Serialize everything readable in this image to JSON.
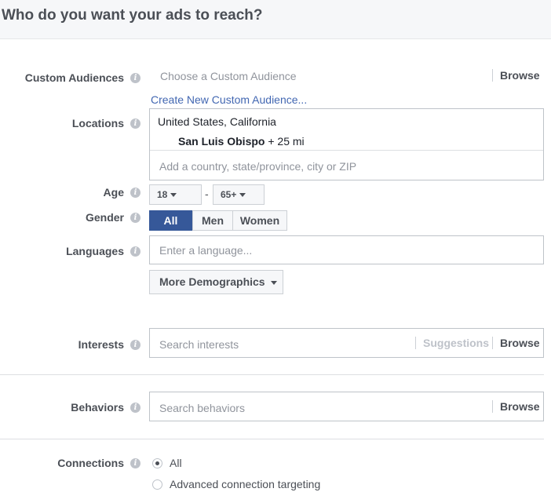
{
  "header": {
    "title": "Who do you want your ads to reach?"
  },
  "custom_audiences": {
    "label": "Custom Audiences",
    "placeholder": "Choose a Custom Audience",
    "browse": "Browse",
    "create_link": "Create New Custom Audience..."
  },
  "locations": {
    "label": "Locations",
    "region": "United States, California",
    "city": "San Luis Obispo",
    "radius": "+ 25 mi",
    "placeholder": "Add a country, state/province, city or ZIP"
  },
  "age": {
    "label": "Age",
    "min": "18",
    "separator": "-",
    "max": "65+"
  },
  "gender": {
    "label": "Gender",
    "options": [
      "All",
      "Men",
      "Women"
    ],
    "selected": "All"
  },
  "languages": {
    "label": "Languages",
    "placeholder": "Enter a language...",
    "more_demographics": "More Demographics"
  },
  "interests": {
    "label": "Interests",
    "placeholder": "Search interests",
    "suggestions": "Suggestions",
    "browse": "Browse"
  },
  "behaviors": {
    "label": "Behaviors",
    "placeholder": "Search behaviors",
    "browse": "Browse"
  },
  "connections": {
    "label": "Connections",
    "options": [
      "All",
      "Advanced connection targeting"
    ],
    "selected": "All"
  },
  "icons": {
    "info": "info-icon",
    "dropdown": "caret-down-icon"
  },
  "colors": {
    "accent": "#365899",
    "link": "#4267b2",
    "header_bg": "#f6f7f9",
    "label_text": "#4b4f56",
    "placeholder": "#90949c"
  }
}
